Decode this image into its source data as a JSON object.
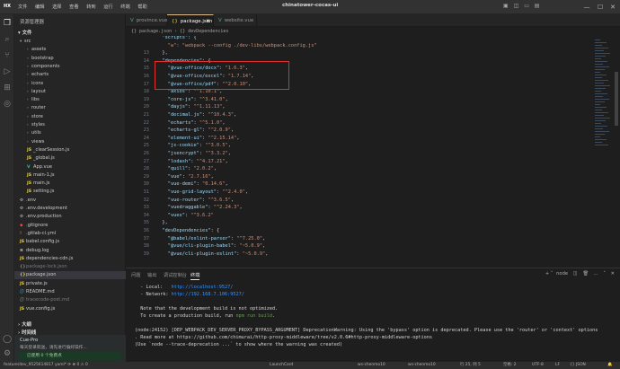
{
  "titlebar": {
    "logo": "HX",
    "menu": [
      "文件",
      "编辑",
      "选择",
      "查看",
      "转到",
      "运行",
      "终端",
      "帮助"
    ],
    "project": "chinatower-cocas-ui",
    "win_minimize": "—",
    "win_maximize": "☐",
    "win_close": "✕"
  },
  "sidebar": {
    "title": "资源管理器",
    "section": "文件",
    "tree": [
      {
        "label": "src",
        "kind": "folder",
        "open": true,
        "indent": 0,
        "iconText": ""
      },
      {
        "label": "assets",
        "kind": "folder",
        "open": false,
        "indent": 1,
        "iconText": ""
      },
      {
        "label": "bootstrap",
        "kind": "folder",
        "open": false,
        "indent": 1,
        "iconText": ""
      },
      {
        "label": "components",
        "kind": "folder",
        "open": false,
        "indent": 1,
        "iconText": ""
      },
      {
        "label": "echarts",
        "kind": "folder",
        "open": false,
        "indent": 1,
        "iconText": ""
      },
      {
        "label": "icons",
        "kind": "folder",
        "open": false,
        "indent": 1,
        "iconText": ""
      },
      {
        "label": "layout",
        "kind": "folder",
        "open": false,
        "indent": 1,
        "iconText": ""
      },
      {
        "label": "libs",
        "kind": "folder",
        "open": false,
        "indent": 1,
        "iconText": ""
      },
      {
        "label": "router",
        "kind": "folder",
        "open": false,
        "indent": 1,
        "iconText": ""
      },
      {
        "label": "store",
        "kind": "folder",
        "open": false,
        "indent": 1,
        "iconText": ""
      },
      {
        "label": "styles",
        "kind": "folder",
        "open": false,
        "indent": 1,
        "iconText": ""
      },
      {
        "label": "utils",
        "kind": "folder",
        "open": false,
        "indent": 1,
        "iconText": ""
      },
      {
        "label": "views",
        "kind": "folder",
        "open": false,
        "indent": 1,
        "iconText": ""
      },
      {
        "label": "_clearSession.js",
        "kind": "file",
        "indent": 1,
        "iconText": "JS",
        "color": "#e8d44d"
      },
      {
        "label": "_global.js",
        "kind": "file",
        "indent": 1,
        "iconText": "JS",
        "color": "#e8d44d"
      },
      {
        "label": "App.vue",
        "kind": "file",
        "indent": 1,
        "iconText": "V",
        "color": "#41b883"
      },
      {
        "label": "main-1.js",
        "kind": "file",
        "indent": 1,
        "iconText": "JS",
        "color": "#e8d44d"
      },
      {
        "label": "main.js",
        "kind": "file",
        "indent": 1,
        "iconText": "JS",
        "color": "#e8d44d"
      },
      {
        "label": "setting.js",
        "kind": "file",
        "indent": 1,
        "iconText": "JS",
        "color": "#e8d44d"
      },
      {
        "label": ".env",
        "kind": "file",
        "indent": 0,
        "iconText": "⚙",
        "color": "#c5c5c5"
      },
      {
        "label": ".env.development",
        "kind": "file",
        "indent": 0,
        "iconText": "⚙",
        "color": "#c5c5c5"
      },
      {
        "label": ".env.production",
        "kind": "file",
        "indent": 0,
        "iconText": "⚙",
        "color": "#c5c5c5"
      },
      {
        "label": ".gitignore",
        "kind": "file",
        "indent": 0,
        "iconText": "◆",
        "color": "#e5533d"
      },
      {
        "label": ".gitlab-ci.yml",
        "kind": "file",
        "indent": 0,
        "iconText": "!",
        "color": "#cb6d51"
      },
      {
        "label": "babel.config.js",
        "kind": "file",
        "indent": 0,
        "iconText": "JS",
        "color": "#e8d44d"
      },
      {
        "label": "debug.log",
        "kind": "file",
        "indent": 0,
        "iconText": "≡",
        "color": "#c5c5c5"
      },
      {
        "label": "dependencies-cdn.js",
        "kind": "file",
        "indent": 0,
        "iconText": "JS",
        "color": "#e8d44d"
      },
      {
        "label": "package-lock.json",
        "kind": "file",
        "indent": 0,
        "iconText": "{}",
        "color": "#8a8a8a",
        "dim": true
      },
      {
        "label": "package.json",
        "kind": "file",
        "indent": 0,
        "iconText": "{}",
        "color": "#e8d44d",
        "selected": true
      },
      {
        "label": "private.js",
        "kind": "file",
        "indent": 0,
        "iconText": "JS",
        "color": "#e8d44d"
      },
      {
        "label": "README.md",
        "kind": "file",
        "indent": 0,
        "iconText": "ⓘ",
        "color": "#519aba"
      },
      {
        "label": "tracecode-post.md",
        "kind": "file",
        "indent": 0,
        "iconText": "ⓘ",
        "color": "#8a8a8a",
        "dim": true
      },
      {
        "label": "vue.config.js",
        "kind": "file",
        "indent": 0,
        "iconText": "JS",
        "color": "#e8d44d"
      }
    ],
    "outline": "大纲",
    "timeline": "时间线",
    "cue_title": "Cue-Pro",
    "cue_desc": "每天登录就送，请先进行偏好操作...",
    "cue_status": "已使用 0 个免费点"
  },
  "tabs": [
    {
      "label": "province.vue",
      "icon": "V",
      "color": "#41b883",
      "active": false
    },
    {
      "label": "package.json",
      "icon": "{}",
      "color": "#e8d44d",
      "active": true
    },
    {
      "label": "website.vue",
      "icon": "V",
      "color": "#41b883",
      "active": false
    }
  ],
  "tab_close": "×",
  "breadcrumb": "{} package.json › {} devDependencies",
  "editor": {
    "lines": [
      {
        "n": "",
        "t": [
          [
            "  \"scripts\": {",
            "k"
          ]
        ]
      },
      {
        "n": "",
        "t": [
          [
            "    \"w\": \"webpack --config ./dev-libs/webpack.config.js\"",
            "s"
          ]
        ]
      },
      {
        "n": "13",
        "t": [
          [
            "  }, ",
            "p"
          ]
        ]
      },
      {
        "n": "14",
        "t": [
          [
            "  \"dependencies\"",
            "k"
          ],
          [
            ": {",
            "p"
          ]
        ]
      },
      {
        "n": "15",
        "t": [
          [
            "    \"@vue-office/docx\"",
            "k"
          ],
          [
            ": ",
            "p"
          ],
          [
            "\"1.6.3\"",
            "s"
          ],
          [
            ",",
            "p"
          ]
        ]
      },
      {
        "n": "16",
        "t": [
          [
            "    \"@vue-office/excel\"",
            "k"
          ],
          [
            ": ",
            "p"
          ],
          [
            "\"1.7.14\"",
            "s"
          ],
          [
            ",",
            "p"
          ]
        ]
      },
      {
        "n": "17",
        "t": [
          [
            "    \"@vue-office/pdf\"",
            "k"
          ],
          [
            ": ",
            "p"
          ],
          [
            "\"^2.0.10\"",
            "s"
          ],
          [
            ",",
            "p"
          ]
        ]
      },
      {
        "n": "18",
        "t": [
          [
            "    \"axios\"",
            "k"
          ],
          [
            ": ",
            "p"
          ],
          [
            "\"^1.10.1\"",
            "s"
          ],
          [
            ",",
            "p"
          ]
        ]
      },
      {
        "n": "19",
        "t": [
          [
            "    \"core-js\"",
            "k"
          ],
          [
            ": ",
            "p"
          ],
          [
            "\"^3.41.0\"",
            "s"
          ],
          [
            ",",
            "p"
          ]
        ]
      },
      {
        "n": "20",
        "t": [
          [
            "    \"dayjs\"",
            "k"
          ],
          [
            ": ",
            "p"
          ],
          [
            "\"^1.11.13\"",
            "s"
          ],
          [
            ",",
            "p"
          ]
        ]
      },
      {
        "n": "21",
        "t": [
          [
            "    \"decimal.js\"",
            "k"
          ],
          [
            ": ",
            "p"
          ],
          [
            "\"^10.4.3\"",
            "s"
          ],
          [
            ",",
            "p"
          ]
        ]
      },
      {
        "n": "22",
        "t": [
          [
            "    \"echarts\"",
            "k"
          ],
          [
            ": ",
            "p"
          ],
          [
            "\"^5.1.0\"",
            "s"
          ],
          [
            ",",
            "p"
          ]
        ]
      },
      {
        "n": "23",
        "t": [
          [
            "    \"echarts-gl\"",
            "k"
          ],
          [
            ": ",
            "p"
          ],
          [
            "\"^2.0.9\"",
            "s"
          ],
          [
            ",",
            "p"
          ]
        ]
      },
      {
        "n": "24",
        "t": [
          [
            "    \"element-ui\"",
            "k"
          ],
          [
            ": ",
            "p"
          ],
          [
            "\"^2.15.14\"",
            "s"
          ],
          [
            ",",
            "p"
          ]
        ]
      },
      {
        "n": "25",
        "t": [
          [
            "    \"js-cookie\"",
            "k"
          ],
          [
            ": ",
            "p"
          ],
          [
            "\"^3.0.5\"",
            "s"
          ],
          [
            ",",
            "p"
          ]
        ]
      },
      {
        "n": "26",
        "t": [
          [
            "    \"jsencrypt\"",
            "k"
          ],
          [
            ": ",
            "p"
          ],
          [
            "\"^3.3.2\"",
            "s"
          ],
          [
            ",",
            "p"
          ]
        ]
      },
      {
        "n": "27",
        "t": [
          [
            "    \"lodash\"",
            "k"
          ],
          [
            ": ",
            "p"
          ],
          [
            "\"^4.17.21\"",
            "s"
          ],
          [
            ",",
            "p"
          ]
        ]
      },
      {
        "n": "28",
        "t": [
          [
            "    \"quill\"",
            "k"
          ],
          [
            ": ",
            "p"
          ],
          [
            "\"2.0.2\"",
            "s"
          ],
          [
            ",",
            "p"
          ]
        ]
      },
      {
        "n": "29",
        "t": [
          [
            "    \"vue\"",
            "k"
          ],
          [
            ": ",
            "p"
          ],
          [
            "\"2.7.16\"",
            "s"
          ],
          [
            ",",
            "p"
          ]
        ]
      },
      {
        "n": "30",
        "t": [
          [
            "    \"vue-demi\"",
            "k"
          ],
          [
            ": ",
            "p"
          ],
          [
            "\"0.14.6\"",
            "s"
          ],
          [
            ",",
            "p"
          ]
        ]
      },
      {
        "n": "31",
        "t": [
          [
            "    \"vue-grid-layout\"",
            "k"
          ],
          [
            ": ",
            "p"
          ],
          [
            "\"^2.4.0\"",
            "s"
          ],
          [
            ",",
            "p"
          ]
        ]
      },
      {
        "n": "32",
        "t": [
          [
            "    \"vue-router\"",
            "k"
          ],
          [
            ": ",
            "p"
          ],
          [
            "\"^3.6.5\"",
            "s"
          ],
          [
            ",",
            "p"
          ]
        ]
      },
      {
        "n": "33",
        "t": [
          [
            "    \"vuedraggable\"",
            "k"
          ],
          [
            ": ",
            "p"
          ],
          [
            "\"^2.24.3\"",
            "s"
          ],
          [
            ",",
            "p"
          ]
        ]
      },
      {
        "n": "34",
        "t": [
          [
            "    \"vuex\"",
            "k"
          ],
          [
            ": ",
            "p"
          ],
          [
            "\"^3.6.2\"",
            "s"
          ]
        ]
      },
      {
        "n": "35",
        "t": [
          [
            "  },",
            "p"
          ]
        ]
      },
      {
        "n": "36",
        "t": [
          [
            "  \"devDependencies\"",
            "k"
          ],
          [
            ": {",
            "p"
          ]
        ]
      },
      {
        "n": "37",
        "t": [
          [
            "    \"@babel/eslint-parser\"",
            "k"
          ],
          [
            ": ",
            "p"
          ],
          [
            "\"^7.25.0\"",
            "s"
          ],
          [
            ",",
            "p"
          ]
        ]
      },
      {
        "n": "38",
        "t": [
          [
            "    \"@vue/cli-plugin-babel\"",
            "k"
          ],
          [
            ": ",
            "p"
          ],
          [
            "\"~5.0.9\"",
            "s"
          ],
          [
            ",",
            "p"
          ]
        ]
      },
      {
        "n": "39",
        "t": [
          [
            "    \"@vue/cli-plugin-eslint\"",
            "k"
          ],
          [
            ": ",
            "p"
          ],
          [
            "\"~5.0.9\"",
            "s"
          ],
          [
            ",",
            "p"
          ]
        ]
      }
    ]
  },
  "panel": {
    "tabs": [
      "问题",
      "输出",
      "调试控制台",
      "终端"
    ],
    "active_tab": "终端",
    "tool_label": "node",
    "lines": [
      {
        "parts": [
          [
            "  - Local:   ",
            "p"
          ],
          [
            "http://localhost:9527/",
            "lnk"
          ]
        ]
      },
      {
        "parts": [
          [
            "  - Network: ",
            "p"
          ],
          [
            "http://192.168.7.106:9527/",
            "lnk"
          ]
        ]
      },
      {
        "parts": [
          [
            "",
            "p"
          ]
        ]
      },
      {
        "parts": [
          [
            "  Note that the development build is not optimized.",
            "p"
          ]
        ]
      },
      {
        "parts": [
          [
            "  To create a production build, run ",
            "p"
          ],
          [
            "npm run build",
            "grn"
          ],
          [
            ".",
            "p"
          ]
        ]
      },
      {
        "parts": [
          [
            "",
            "p"
          ]
        ]
      },
      {
        "parts": [
          [
            "(node:24152) [DEP_WEBPACK_DEV_SERVER_PROXY_BYPASS_ARGUMENT] DeprecationWarning: Using the 'bypass' option is deprecated. Please use the 'router' or 'context' options",
            "p"
          ]
        ]
      },
      {
        "parts": [
          [
            ". Read more at https://github.com/chimurai/http-proxy-middleware/tree/v2.0.6#http-proxy-middleware-options",
            "p"
          ]
        ]
      },
      {
        "parts": [
          [
            "(Use `node --trace-deprecation ...` to show where the warning was created)",
            "p"
          ]
        ]
      }
    ]
  },
  "statusbar": {
    "left": "feature/dev_9525614817 yaml* ⟳  ⊗ 0 ⚠ 0",
    "mid1": "LaunchCard",
    "right": [
      "ws-chenmo10",
      "ws-chenmo10",
      "行 25, 列 5",
      "空格: 2",
      "UTF-8",
      "LF",
      "{} JSON"
    ]
  }
}
